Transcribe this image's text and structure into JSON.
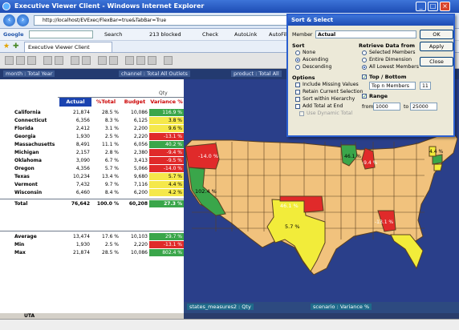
{
  "window": {
    "title": "Executive Viewer Client - Windows Internet Explorer"
  },
  "browser": {
    "address": "http://localhost/EVExec/FlexBar=true&TabBar=True",
    "google_label": "Google",
    "google_items": [
      "Search",
      "213 blocked",
      "Check",
      "AutoLink",
      "AutoFill"
    ],
    "tab_label": "Executive Viewer Client"
  },
  "viewbar": [
    "month : Total Year",
    "channel : Total All Outlets",
    "product : Total All"
  ],
  "grid": {
    "measure_label": "Qty",
    "columns": [
      "Actual",
      "%Total",
      "Budget",
      "Variance %"
    ],
    "rows": [
      {
        "label": "California",
        "actual": "21,874",
        "pct": "28.5 %",
        "budget": "10,086",
        "variance": "116.9 %",
        "color": "#3aa64a"
      },
      {
        "label": "Connecticut",
        "actual": "6,356",
        "pct": "8.3 %",
        "budget": "6,125",
        "variance": "3.8 %",
        "color": "#f5e84a"
      },
      {
        "label": "Florida",
        "actual": "2,412",
        "pct": "3.1 %",
        "budget": "2,200",
        "variance": "9.6 %",
        "color": "#f5e84a"
      },
      {
        "label": "Georgia",
        "actual": "1,930",
        "pct": "2.5 %",
        "budget": "2,220",
        "variance": "-13.1 %",
        "color": "#e02a2a"
      },
      {
        "label": "Massachusetts",
        "actual": "8,491",
        "pct": "11.1 %",
        "budget": "6,056",
        "variance": "40.2 %",
        "color": "#3aa64a"
      },
      {
        "label": "Michigan",
        "actual": "2,157",
        "pct": "2.8 %",
        "budget": "2,380",
        "variance": "-9.4 %",
        "color": "#e02a2a"
      },
      {
        "label": "Oklahoma",
        "actual": "3,090",
        "pct": "6.7 %",
        "budget": "3,413",
        "variance": "-9.5 %",
        "color": "#e02a2a"
      },
      {
        "label": "Oregon",
        "actual": "4,356",
        "pct": "5.7 %",
        "budget": "5,066",
        "variance": "-14.0 %",
        "color": "#e02a2a"
      },
      {
        "label": "Texas",
        "actual": "10,234",
        "pct": "13.4 %",
        "budget": "9,680",
        "variance": "5.7 %",
        "color": "#f5e84a"
      },
      {
        "label": "Vermont",
        "actual": "7,432",
        "pct": "9.7 %",
        "budget": "7,116",
        "variance": "4.4 %",
        "color": "#f5e84a"
      },
      {
        "label": "Wisconsin",
        "actual": "6,460",
        "pct": "8.4 %",
        "budget": "6,200",
        "variance": "4.2 %",
        "color": "#f5e84a"
      }
    ],
    "total": {
      "label": "Total",
      "actual": "76,642",
      "pct": "100.0 %",
      "budget": "60,208",
      "variance": "27.3 %",
      "color": "#3aa64a"
    },
    "stats": [
      {
        "label": "Average",
        "actual": "13,474",
        "pct": "17.6 %",
        "budget": "10,103",
        "variance": "29.7 %",
        "color": "#3aa64a"
      },
      {
        "label": "Min",
        "actual": "1,930",
        "pct": "2.5 %",
        "budget": "2,220",
        "variance": "-13.1 %",
        "color": "#e02a2a"
      },
      {
        "label": "Max",
        "actual": "21,874",
        "pct": "28.5 %",
        "budget": "10,086",
        "variance": "802.4 %",
        "color": "#3aa64a"
      }
    ]
  },
  "map": {
    "labels": [
      "-14.0 %",
      "102.4 %",
      "5.7 %",
      "46.1 %",
      "-9.4 %",
      "-13.1 %",
      "4.4 %"
    ],
    "footer_left": "states_measures2 : Qty",
    "footer_right": "scenario : Variance %",
    "colors": {
      "green": "#3aa64a",
      "yellow": "#f2ec3a",
      "red": "#e02a2a",
      "orange": "#f1c27d",
      "water": "#2a3f8a"
    }
  },
  "dialog": {
    "title": "Sort & Select",
    "member_label": "Member",
    "member_value": "Actual",
    "buttons": [
      "OK",
      "Apply",
      "Close"
    ],
    "sort_header": "Sort",
    "sort_options": [
      "None",
      "Ascending",
      "Descending"
    ],
    "retrieve_header": "Retrieve Data from",
    "retrieve_options": [
      "Selected Members",
      "Entire Dimension",
      "All Lowest Members"
    ],
    "options_header": "Options",
    "options": [
      "Include Missing Values",
      "Retain Current Selection",
      "Sort within Hierarchy",
      "Add Total at End",
      "Use Dynamic Total"
    ],
    "top_bottom_label": "Top / Bottom",
    "top_bottom_value": "Top n Members",
    "top_n": "11",
    "range_label": "Range",
    "from_label": "from",
    "from_value": "1000",
    "to_label": "to",
    "to_value": "25000"
  },
  "sheet_tab": "UTA"
}
